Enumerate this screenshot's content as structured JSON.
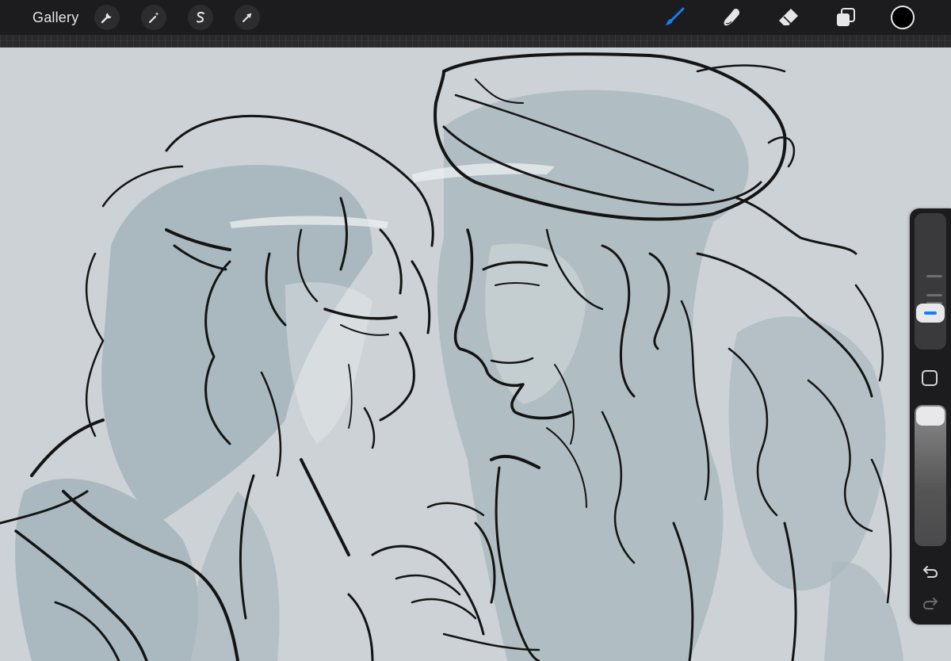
{
  "toolbar": {
    "gallery_label": "Gallery",
    "left_tools": [
      {
        "name": "actions",
        "icon": "wrench-icon"
      },
      {
        "name": "adjustments",
        "icon": "magic-wand-icon"
      },
      {
        "name": "selection",
        "icon": "s-curve-icon"
      },
      {
        "name": "transform",
        "icon": "arrow-cursor-icon"
      }
    ],
    "right_tools": [
      {
        "name": "brush",
        "icon": "brush-icon",
        "active": true
      },
      {
        "name": "smudge",
        "icon": "smudge-icon",
        "active": false
      },
      {
        "name": "eraser",
        "icon": "eraser-icon",
        "active": false
      },
      {
        "name": "layers",
        "icon": "layers-icon",
        "active": false
      }
    ],
    "current_color": "#000000",
    "active_accent": "#1a7cf5"
  },
  "sidebar": {
    "brush_size_level": 0.22,
    "opacity_level": 1.0,
    "icons": [
      "square-modify-icon",
      "undo-icon",
      "redo-icon"
    ]
  },
  "canvas": {
    "background": "#ccd2d6",
    "wash_color": "#8fa4ad",
    "line_color": "#141414"
  }
}
